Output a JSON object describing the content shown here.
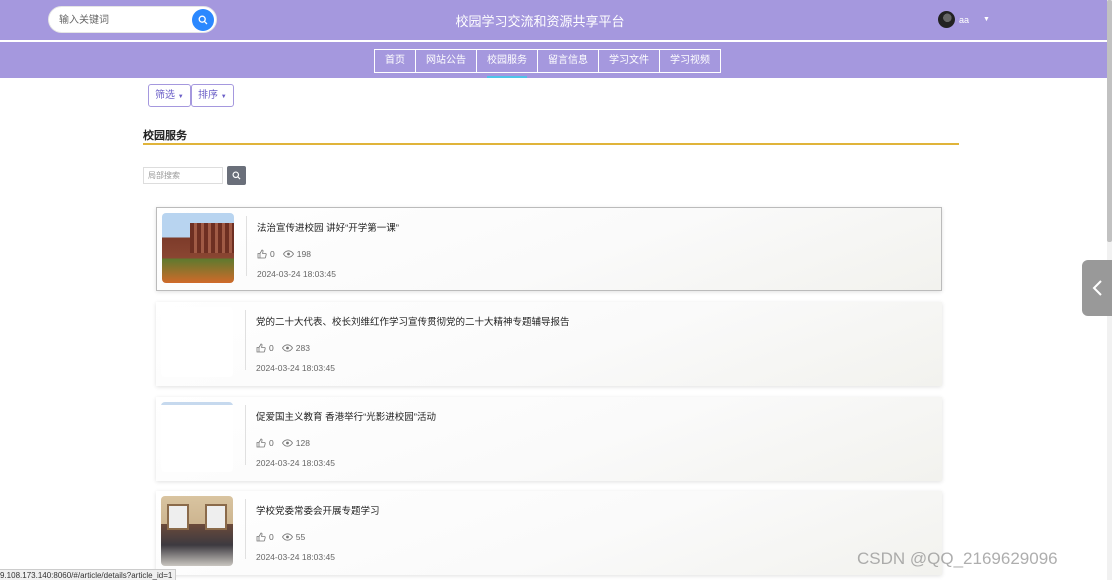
{
  "header": {
    "search_placeholder": "输入关键词",
    "site_title": "校园学习交流和资源共享平台",
    "username": "aa"
  },
  "nav": {
    "items": [
      {
        "label": "首页"
      },
      {
        "label": "网站公告"
      },
      {
        "label": "校园服务"
      },
      {
        "label": "留言信息"
      },
      {
        "label": "学习文件"
      },
      {
        "label": "学习视频"
      }
    ],
    "active_index": 2
  },
  "filters": {
    "filter_label": "筛选",
    "sort_label": "排序"
  },
  "section": {
    "title": "校园服务",
    "local_search_placeholder": "局部搜索"
  },
  "articles": [
    {
      "title": "法治宣传进校园 讲好“开学第一课”",
      "likes": "0",
      "views": "198",
      "date": "2024-03-24 18:03:45"
    },
    {
      "title": "党的二十大代表、校长刘维红作学习宣传贯彻党的二十大精神专题辅导报告",
      "likes": "0",
      "views": "283",
      "date": "2024-03-24 18:03:45"
    },
    {
      "title": "促爱国主义教育 香港举行“光影进校园”活动",
      "likes": "0",
      "views": "128",
      "date": "2024-03-24 18:03:45"
    },
    {
      "title": "学校党委常委会开展专题学习",
      "likes": "0",
      "views": "55",
      "date": "2024-03-24 18:03:45"
    }
  ],
  "status_bar": {
    "url": "9.108.173.140:8060/#/article/details?article_id=1"
  },
  "watermark": "CSDN @QQ_2169629096",
  "colors": {
    "header_bg": "#a598de",
    "search_button": "#2b88ff",
    "section_underline": "#e0b43a",
    "active_tab_indicator": "#4fc3e8"
  }
}
